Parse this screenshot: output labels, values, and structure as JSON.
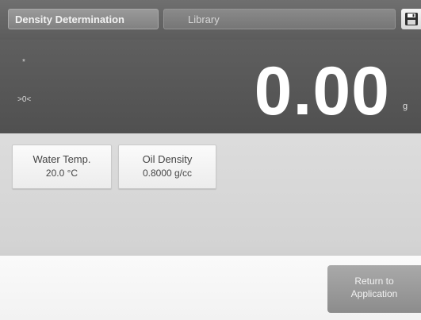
{
  "header": {
    "tabs": [
      {
        "label": "Density Determination",
        "active": true
      },
      {
        "label": "Library",
        "active": false
      }
    ],
    "save_icon": "floppy-disk-icon"
  },
  "display": {
    "indicator_top": "*",
    "indicator_zero": ">0<",
    "weight": "0.00",
    "unit": "g"
  },
  "params": [
    {
      "label": "Water Temp.",
      "value": "20.0 °C"
    },
    {
      "label": "Oil Density",
      "value": "0.8000 g/cc"
    }
  ],
  "footer": {
    "return_line1": "Return to",
    "return_line2": "Application"
  },
  "colors": {
    "display_bg": "#555555",
    "topbar_bg": "#666666",
    "weight_text": "#ffffff"
  }
}
